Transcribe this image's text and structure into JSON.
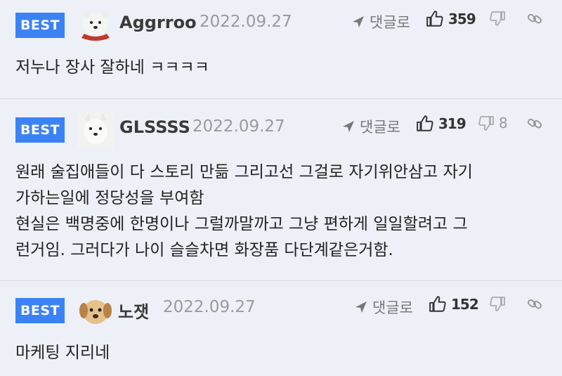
{
  "comments": [
    {
      "badge": "BEST",
      "author": "Aggrroo",
      "date": "2022.09.27",
      "reply_label": "댓글로",
      "likes": "359",
      "dislikes": "",
      "text": "저누나 장사 잘하네 ㅋㅋㅋㅋ",
      "avatar": "polar-bear-avatar"
    },
    {
      "badge": "BEST",
      "author": "GLSSSS",
      "date": "2022.09.27",
      "reply_label": "댓글로",
      "likes": "319",
      "dislikes": "8",
      "text": "원래 술집애들이 다 스토리 만듦 그리고선 그걸로 자기위안삼고 자기\n가하는일에 정당성을 부여함\n현실은 백명중에 한명이나 그럴까말까고 그냥 편하게 일일할려고 그\n런거임. 그러다가 나이 슬슬차면 화장품 다단계같은거함.",
      "avatar": "white-dog-avatar"
    },
    {
      "badge": "BEST",
      "author": "노잿",
      "date": "2022.09.27",
      "reply_label": "댓글로",
      "likes": "152",
      "dislikes": "",
      "text": "마케팅 지리네",
      "avatar": "puppy-avatar"
    }
  ],
  "colors": {
    "badge": "#3b82f6",
    "background": "#eef0f7",
    "divider": "#d6d8e0"
  },
  "icons": [
    "reply-arrow-icon",
    "thumbs-up-icon",
    "thumbs-down-icon",
    "share-link-icon"
  ]
}
